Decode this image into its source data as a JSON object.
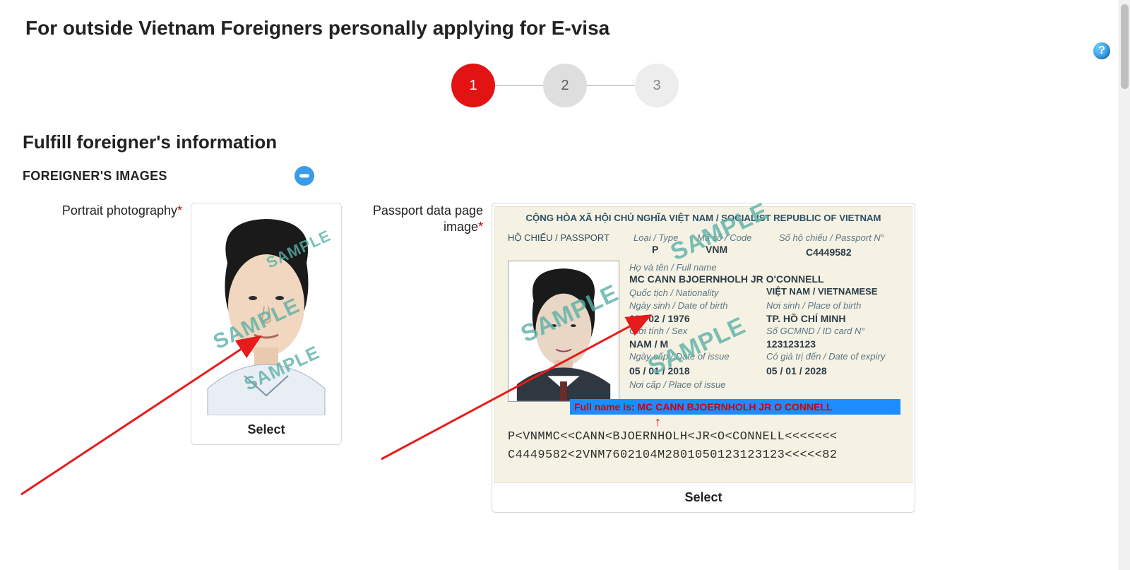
{
  "page_title": "For outside Vietnam Foreigners personally applying for E-visa",
  "help_icon": "?",
  "stepper": {
    "steps": [
      "1",
      "2",
      "3"
    ],
    "active_index": 0
  },
  "section_heading": "Fulfill foreigner's information",
  "images_section": {
    "heading": "FOREIGNER'S IMAGES",
    "portrait_label": "Portrait photography",
    "passport_label": "Passport data page image",
    "required_mark": "*",
    "select_label": "Select",
    "sample_watermark": "SAMPLE"
  },
  "passport_sample": {
    "country_header": "CỘNG HÒA XÃ HỘI CHỦ NGHĨA VIỆT NAM / SOCIALIST REPUBLIC OF VIETNAM",
    "labels": {
      "passport": "HỘ CHIẾU / PASSPORT",
      "type": "Loại / Type",
      "code": "Mã số / Code",
      "number": "Số hộ chiếu / Passport N°",
      "fullname": "Họ và tên / Full name",
      "nationality": "Quốc tịch / Nationality",
      "dob": "Ngày sinh / Date of birth",
      "pob": "Nơi sinh / Place of birth",
      "sex": "Giới tính / Sex",
      "idcard": "Số GCMND / ID card N°",
      "doi": "Ngày cấp / Date of issue",
      "doe": "Có giá trị đến / Date of expiry",
      "poi": "Nơi cấp / Place of issue"
    },
    "values": {
      "type": "P",
      "code": "VNM",
      "number": "C4449582",
      "fullname": "MC CANN BJOERNHOLH JR O'CONNELL",
      "nationality": "VIỆT NAM / VIETNAMESE",
      "dob": "10 / 02 / 1976",
      "pob": "TP. HỒ CHÍ MINH",
      "sex": "NAM / M",
      "idcard": "123123123",
      "doi": "05 / 01 / 2018",
      "doe": "05 / 01 / 2028"
    },
    "highlight_text": "Full name is: MC CANN BJOERNHOLH JR O CONNELL",
    "mrz_line1": "P<VNMMC<<CANN<BJOERNHOLH<JR<O<CONNELL<<<<<<<",
    "mrz_line2": "C4449582<2VNM7602104M2801050123123123<<<<<82"
  }
}
